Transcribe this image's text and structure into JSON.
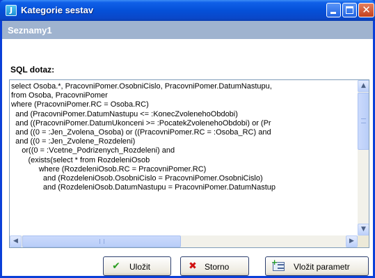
{
  "window": {
    "title": "Kategorie sestav",
    "app_icon_letter": "J"
  },
  "subheader": "Seznamy1",
  "sql_label": "SQL dotaz:",
  "sql_lines": [
    "select Osoba.*, PracovniPomer.OsobniCislo, PracovniPomer.DatumNastupu,",
    "from Osoba, PracovniPomer",
    "where (PracovniPomer.RC = Osoba.RC)",
    "  and (PracovniPomer.DatumNastupu <= :KonecZvolenehoObdobi)",
    "  and ((PracovniPomer.DatumUkonceni >= :PocatekZvolenehoObdobi) or (Pr",
    "  and ((0 = :Jen_Zvolena_Osoba) or ((PracovniPomer.RC = :Osoba_RC) and",
    "  and ((0 = :Jen_Zvolene_Rozdeleni)",
    "     or((0 = :Vcetne_Podrizenych_Rozdeleni) and",
    "        (exists(select * from RozdeleniOsob",
    "             where (RozdeleniOsob.RC = PracovniPomer.RC)",
    "               and (RozdeleniOsob.OsobniCislo = PracovniPomer.OsobniCislo)",
    "               and (RozdeleniOsob.DatumNastupu = PracovniPomer.DatumNastup"
  ],
  "buttons": {
    "save": "Uložit",
    "cancel": "Storno",
    "insert_param": "Vložit parametr"
  },
  "icons": {
    "app": "app-icon",
    "minimize": "minimize-icon",
    "maximize": "maximize-icon",
    "close": "close-icon",
    "save": "checkmark-icon",
    "cancel": "cross-icon",
    "insert_param": "insert-parameter-icon",
    "scroll_up": "arrow-up-icon",
    "scroll_down": "arrow-down-icon",
    "scroll_left": "arrow-left-icon",
    "scroll_right": "arrow-right-icon"
  },
  "colors": {
    "titlebar": "#0550d8",
    "subheader_bg": "#9fb3cf",
    "save_icon": "#2a9d20",
    "cancel_icon": "#d01010"
  }
}
